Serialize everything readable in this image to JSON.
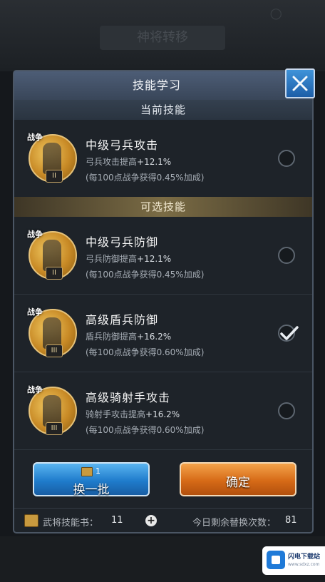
{
  "background": {
    "ghost_title": "神将转移",
    "dot": "○"
  },
  "dialog": {
    "title": "技能学习",
    "current_section": "当前技能",
    "optional_section": "可选技能",
    "current_skill": {
      "name": "中级弓兵攻击",
      "effect_prefix": "弓兵攻击提高",
      "effect_value": "+12.1%",
      "bonus": "(每100点战争获得0.45%加成)",
      "badge": "战争",
      "rank": "II",
      "selected": false
    },
    "options": [
      {
        "name": "中级弓兵防御",
        "effect_prefix": "弓兵防御提高",
        "effect_value": "+12.1%",
        "bonus": "(每100点战争获得0.45%加成)",
        "badge": "战争",
        "rank": "II",
        "selected": false
      },
      {
        "name": "高级盾兵防御",
        "effect_prefix": "盾兵防御提高",
        "effect_value": "+16.2%",
        "bonus": "(每100点战争获得0.60%加成)",
        "badge": "战争",
        "rank": "III",
        "selected": true
      },
      {
        "name": "高级骑射手攻击",
        "effect_prefix": "骑射手攻击提高",
        "effect_value": "+16.2%",
        "bonus": "(每100点战争获得0.60%加成)",
        "badge": "战争",
        "rank": "III",
        "selected": false
      }
    ],
    "buttons": {
      "refresh_label": "换一批",
      "refresh_cost": "1",
      "confirm_label": "确定"
    },
    "footer": {
      "books_label": "武将技能书：",
      "books_value": "11",
      "plus": "+",
      "remaining_label": "今日剩余替换次数：",
      "remaining_value": "81"
    }
  },
  "watermark": {
    "line1": "闪电下载站",
    "line2": "www.sdxz.com"
  },
  "icons": {
    "close": "close-icon",
    "check": "check-icon",
    "book": "book-icon",
    "plus": "plus-icon"
  },
  "colors": {
    "refresh_button": "#1f7ccc",
    "confirm_button": "#d66a17",
    "title_bar": "#4d5d76",
    "optional_header": "#7b6c45"
  }
}
